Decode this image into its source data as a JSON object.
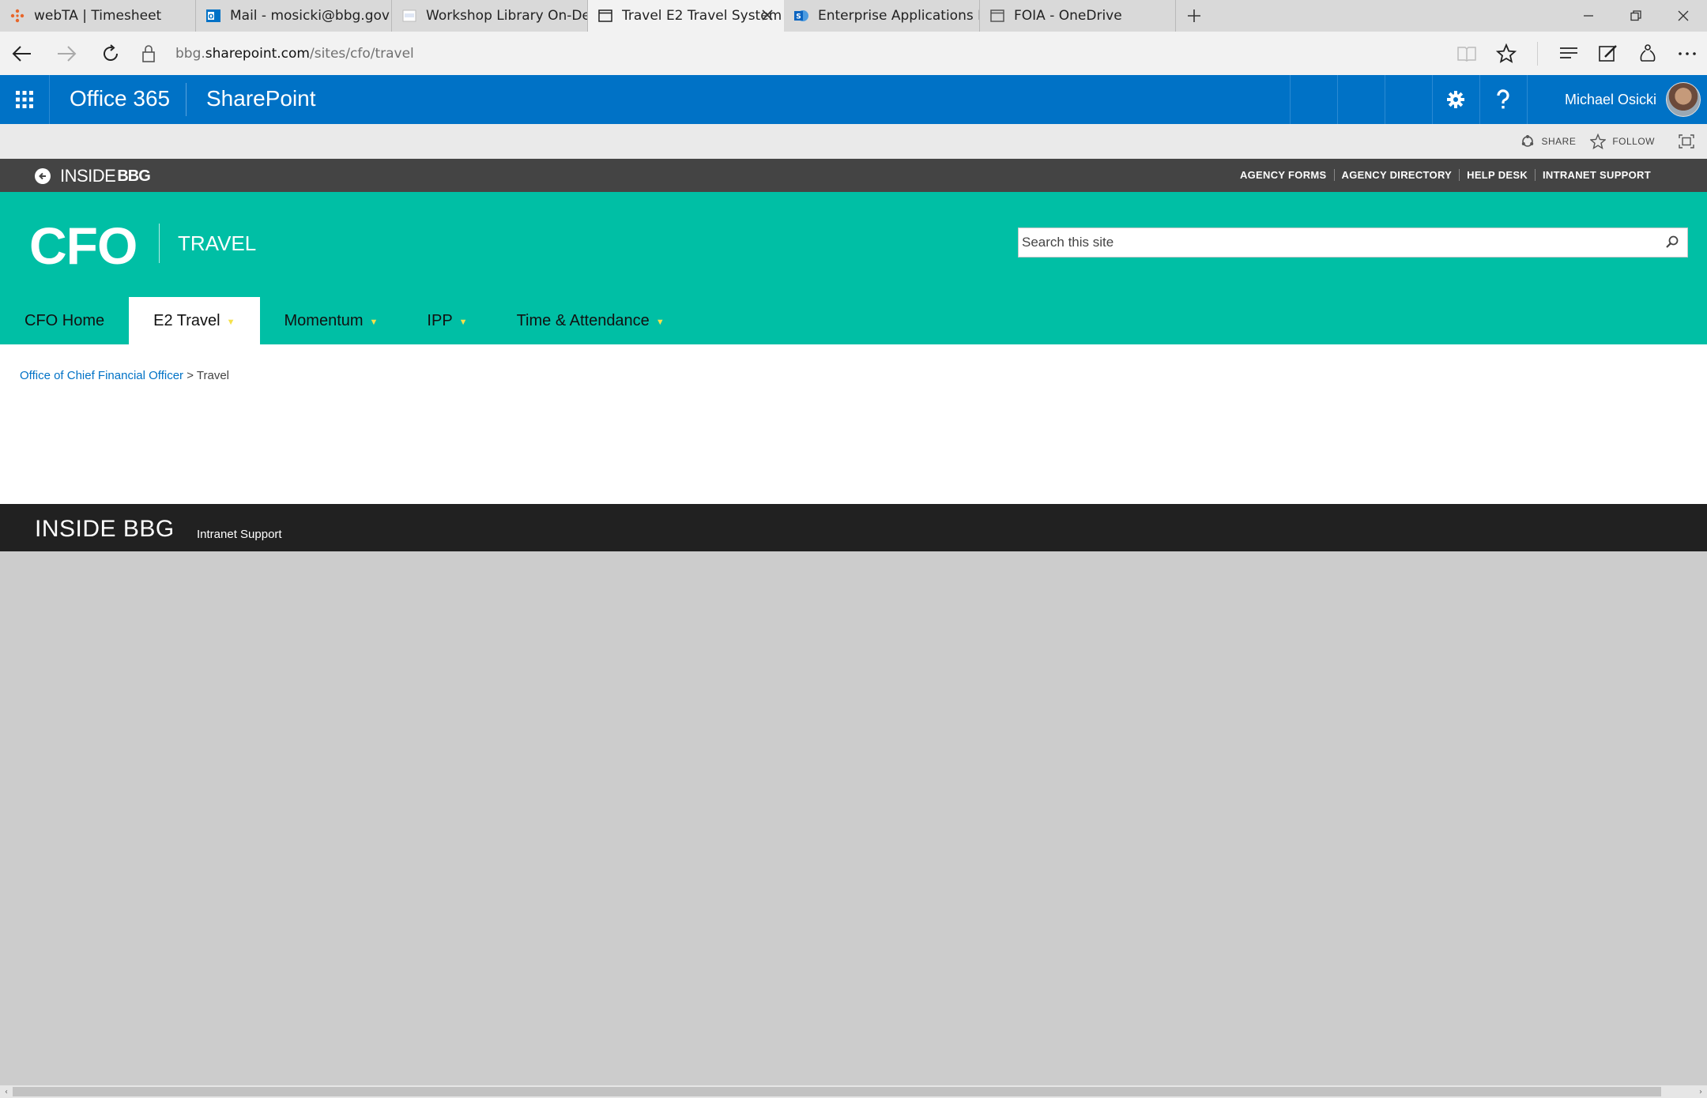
{
  "browser": {
    "tabs": [
      {
        "label": "webTA | Timesheet",
        "icon": "webta-icon",
        "active": false
      },
      {
        "label": "Mail - mosicki@bbg.gov",
        "icon": "outlook-icon",
        "active": false
      },
      {
        "label": "Workshop Library On-Dema",
        "icon": "onenote-icon",
        "active": false
      },
      {
        "label": "Travel E2 Travel System",
        "icon": "page-icon",
        "active": true
      },
      {
        "label": "Enterprise Applications Limi",
        "icon": "sharepoint-icon",
        "active": false
      },
      {
        "label": "FOIA - OneDrive",
        "icon": "page-icon",
        "active": false
      }
    ],
    "url_prefix": "bbg.",
    "url_domain": "sharepoint.com",
    "url_path": "/sites/cfo/travel"
  },
  "suitebar": {
    "app": "Office 365",
    "product": "SharePoint",
    "user": "Michael Osicki",
    "colors": {
      "bar": "#0072c6"
    }
  },
  "actions": {
    "share": "SHARE",
    "follow": "FOLLOW"
  },
  "insidebar": {
    "brand": "INSIDE",
    "brand_mark": "BBG",
    "links": [
      "AGENCY FORMS",
      "AGENCY DIRECTORY",
      "HELP DESK",
      "INTRANET SUPPORT"
    ]
  },
  "header": {
    "logo": "CFO",
    "site_title": "TRAVEL",
    "search_placeholder": "Search this site",
    "colors": {
      "accent": "#00bfa5"
    },
    "nav": [
      {
        "label": "CFO Home",
        "dropdown": false,
        "selected": false
      },
      {
        "label": "E2 Travel",
        "dropdown": true,
        "selected": true
      },
      {
        "label": "Momentum",
        "dropdown": true,
        "selected": false
      },
      {
        "label": "IPP",
        "dropdown": true,
        "selected": false
      },
      {
        "label": "Time & Attendance",
        "dropdown": true,
        "selected": false
      }
    ]
  },
  "breadcrumb": {
    "parent": "Office of Chief Financial Officer",
    "separator": ">",
    "current": "Travel"
  },
  "footer": {
    "title": "INSIDE BBG",
    "link": "Intranet Support"
  }
}
